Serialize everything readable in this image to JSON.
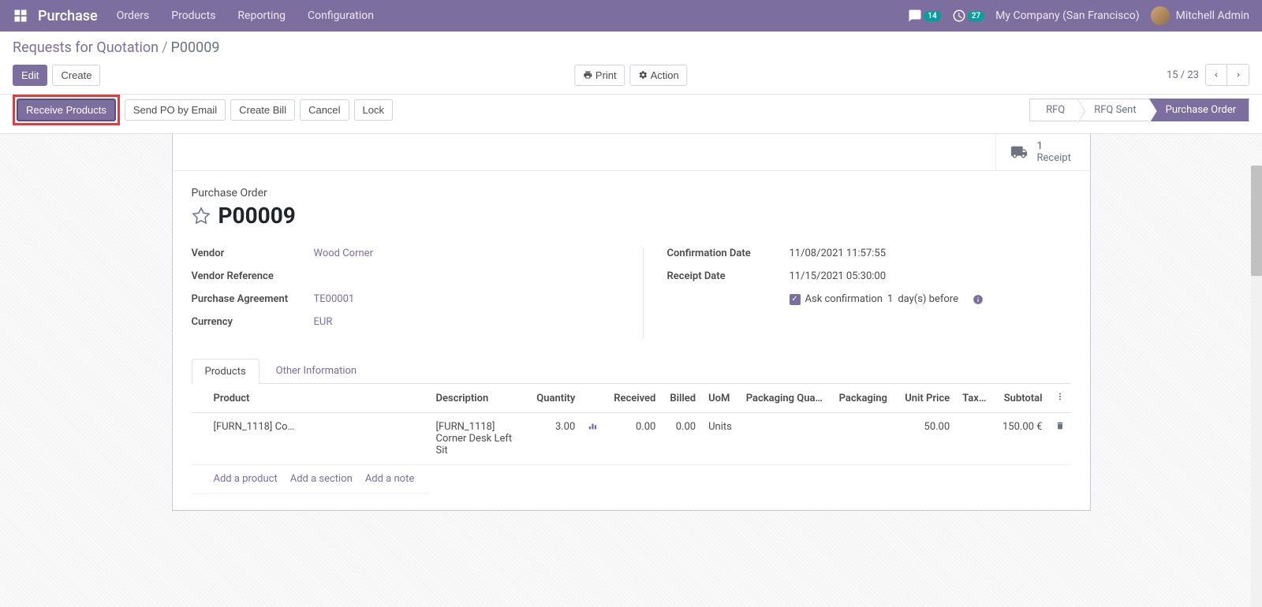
{
  "topnav": {
    "brand": "Purchase",
    "menu": [
      "Orders",
      "Products",
      "Reporting",
      "Configuration"
    ],
    "msg_badge": "14",
    "activity_badge": "27",
    "company": "My Company (San Francisco)",
    "user": "Mitchell Admin"
  },
  "breadcrumb": {
    "root": "Requests for Quotation",
    "current": "P00009"
  },
  "ctrl": {
    "edit": "Edit",
    "create": "Create",
    "print": "Print",
    "action": "Action",
    "pager": "15 / 23"
  },
  "actions": {
    "receive": "Receive Products",
    "sendpo": "Send PO by Email",
    "createbill": "Create Bill",
    "cancel": "Cancel",
    "lock": "Lock"
  },
  "status": [
    "RFQ",
    "RFQ Sent",
    "Purchase Order"
  ],
  "statbtn": {
    "count": "1",
    "label": "Receipt"
  },
  "form": {
    "title_label": "Purchase Order",
    "name": "P00009",
    "vendor_label": "Vendor",
    "vendor": "Wood Corner",
    "vendorref_label": "Vendor Reference",
    "vendorref": "",
    "agreement_label": "Purchase Agreement",
    "agreement": "TE00001",
    "currency_label": "Currency",
    "currency": "EUR",
    "confdate_label": "Confirmation Date",
    "confdate": "11/08/2021 11:57:55",
    "receiptdate_label": "Receipt Date",
    "receiptdate": "11/15/2021 05:30:00",
    "remind_text1": "Ask confirmation",
    "remind_days": "1",
    "remind_text2": "day(s) before"
  },
  "tabs": {
    "products": "Products",
    "other": "Other Information"
  },
  "table": {
    "headers": {
      "product": "Product",
      "description": "Description",
      "quantity": "Quantity",
      "received": "Received",
      "billed": "Billed",
      "uom": "UoM",
      "pkgqty": "Packaging Qua…",
      "pkg": "Packaging",
      "unitprice": "Unit Price",
      "taxes": "Tax…",
      "subtotal": "Subtotal"
    },
    "row": {
      "product": "[FURN_1118] Co…",
      "description": "[FURN_1118] Corner Desk Left Sit",
      "quantity": "3.00",
      "received": "0.00",
      "billed": "0.00",
      "uom": "Units",
      "pkgqty": "",
      "pkg": "",
      "unitprice": "50.00",
      "taxes": "",
      "subtotal": "150.00 €"
    },
    "addproduct": "Add a product",
    "addsection": "Add a section",
    "addnote": "Add a note"
  }
}
